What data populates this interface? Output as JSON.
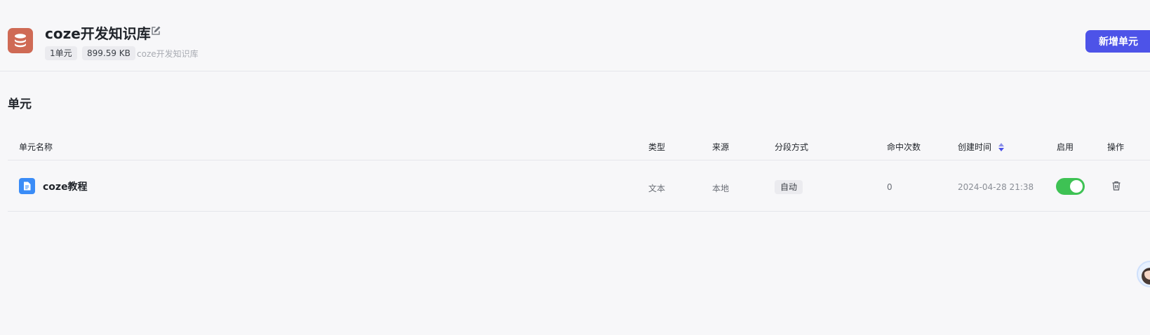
{
  "knowledge_base": {
    "title": "coze开发知识库",
    "unit_count": "1单元",
    "size": "899.59 KB",
    "description": "coze开发知识库",
    "icon": "database-icon",
    "icon_color": "#cf6a55"
  },
  "toolbar": {
    "add_unit_label": "新增单元",
    "accent_color": "#4d53e8"
  },
  "section": {
    "title": "单元"
  },
  "table": {
    "columns": {
      "name": "单元名称",
      "type": "类型",
      "source": "来源",
      "segmentation": "分段方式",
      "hits": "命中次数",
      "created": "创建时间",
      "enabled": "启用",
      "actions": "操作"
    },
    "rows": [
      {
        "name": "coze教程",
        "type": "文本",
        "source": "本地",
        "segmentation": "自动",
        "hits": "0",
        "created": "2024-04-28 21:38",
        "enabled": true
      }
    ]
  }
}
